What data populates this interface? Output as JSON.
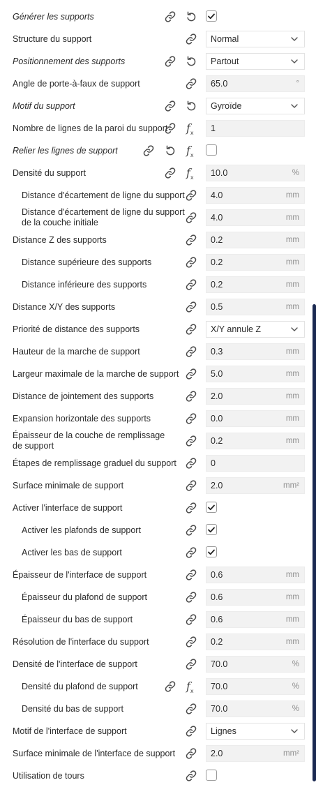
{
  "settings": {
    "generate_support": {
      "label": "Générer les supports",
      "checked": true
    },
    "support_structure": {
      "label": "Structure du support",
      "value": "Normal"
    },
    "support_placement": {
      "label": "Positionnement des supports",
      "value": "Partout"
    },
    "support_angle": {
      "label": "Angle de porte-à-faux de support",
      "value": "65.0",
      "unit": "°"
    },
    "support_pattern": {
      "label": "Motif du support",
      "value": "Gyroïde"
    },
    "support_wall_count": {
      "label": "Nombre de lignes de la paroi du support",
      "value": "1"
    },
    "support_connect": {
      "label": "Relier les lignes de support",
      "checked": false
    },
    "support_density": {
      "label": "Densité du support",
      "value": "10.0",
      "unit": "%"
    },
    "support_line_distance": {
      "label": "Distance d'écartement de ligne du support",
      "value": "4.0",
      "unit": "mm"
    },
    "support_initial_line_distance": {
      "label": "Distance d'écartement de ligne du support de la couche initiale",
      "value": "4.0",
      "unit": "mm"
    },
    "support_z_distance": {
      "label": "Distance Z des supports",
      "value": "0.2",
      "unit": "mm"
    },
    "support_top_distance": {
      "label": "Distance supérieure des supports",
      "value": "0.2",
      "unit": "mm"
    },
    "support_bottom_distance": {
      "label": "Distance inférieure des supports",
      "value": "0.2",
      "unit": "mm"
    },
    "support_xy_distance": {
      "label": "Distance X/Y des supports",
      "value": "0.5",
      "unit": "mm"
    },
    "support_xy_priority": {
      "label": "Priorité de distance des supports",
      "value": "X/Y annule Z"
    },
    "support_step_height": {
      "label": "Hauteur de la marche de support",
      "value": "0.3",
      "unit": "mm"
    },
    "support_step_width": {
      "label": "Largeur maximale de la marche de support",
      "value": "5.0",
      "unit": "mm"
    },
    "support_join_distance": {
      "label": "Distance de jointement des supports",
      "value": "2.0",
      "unit": "mm"
    },
    "support_offset": {
      "label": "Expansion horizontale des supports",
      "value": "0.0",
      "unit": "mm"
    },
    "support_infill_thickness": {
      "label": "Épaisseur de la couche de remplissage de support",
      "value": "0.2",
      "unit": "mm"
    },
    "support_gradual_steps": {
      "label": "Étapes de remplissage graduel du support",
      "value": "0"
    },
    "support_min_area": {
      "label": "Surface minimale de support",
      "value": "2.0",
      "unit": "mm²"
    },
    "support_interface_enable": {
      "label": "Activer l'interface de support",
      "checked": true
    },
    "support_roof_enable": {
      "label": "Activer les plafonds de support",
      "checked": true
    },
    "support_bottom_enable": {
      "label": "Activer les bas de support",
      "checked": true
    },
    "support_interface_height": {
      "label": "Épaisseur de l'interface de support",
      "value": "0.6",
      "unit": "mm"
    },
    "support_roof_height": {
      "label": "Épaisseur du plafond de support",
      "value": "0.6",
      "unit": "mm"
    },
    "support_bottom_height": {
      "label": "Épaisseur du bas de support",
      "value": "0.6",
      "unit": "mm"
    },
    "support_interface_resolution": {
      "label": "Résolution de l'interface du support",
      "value": "0.2",
      "unit": "mm"
    },
    "support_interface_density": {
      "label": "Densité de l'interface de support",
      "value": "70.0",
      "unit": "%"
    },
    "support_roof_density": {
      "label": "Densité du plafond de support",
      "value": "70.0",
      "unit": "%"
    },
    "support_bottom_density": {
      "label": "Densité du bas de support",
      "value": "70.0",
      "unit": "%"
    },
    "support_interface_pattern": {
      "label": "Motif de l'interface de support",
      "value": "Lignes"
    },
    "support_interface_min_area": {
      "label": "Surface minimale de l'interface de support",
      "value": "2.0",
      "unit": "mm²"
    },
    "use_towers": {
      "label": "Utilisation de tours",
      "checked": false
    }
  },
  "icons": {
    "link": "link-icon",
    "reset": "reset-icon",
    "formula": "fx-icon",
    "dropdown": "chevron-down-icon",
    "check": "check-icon"
  },
  "colors": {
    "scrollbar": "#1b2a52",
    "field_bg": "#f2f2f2",
    "text": "#2b2b2b",
    "unit": "#8f8f8f"
  }
}
